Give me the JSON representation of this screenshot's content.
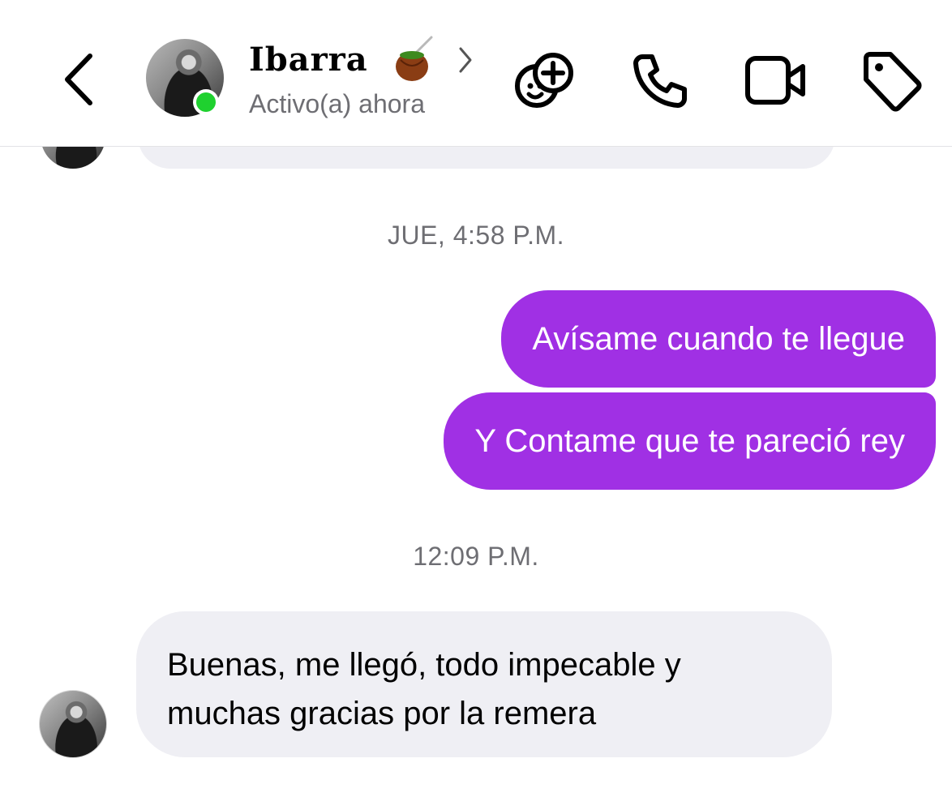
{
  "header": {
    "contact_name": "Ibarra",
    "status_text": "Activo(a) ahora",
    "icons": {
      "back": "chevron-left-icon",
      "mate": "mate-gourd-emoji",
      "details": "chevron-right-icon",
      "effects": "add-effects-icon",
      "call": "phone-icon",
      "video": "video-camera-icon",
      "tag": "tag-icon"
    },
    "online_color": "#1fd12f"
  },
  "chat": {
    "timestamp_1": "JUE, 4:58 P.M.",
    "outgoing": [
      "Avísame cuando te llegue",
      "Y Contame que te pareció rey"
    ],
    "timestamp_2": "12:09 P.M.",
    "incoming": {
      "line_1": "Buenas, me llegó, todo impecable y",
      "line_2": "muchas gracias por la remera"
    }
  },
  "colors": {
    "outgoing_bubble": "#a030e4",
    "incoming_bubble": "#efeff4",
    "timestamp_text": "#6e6e73"
  }
}
